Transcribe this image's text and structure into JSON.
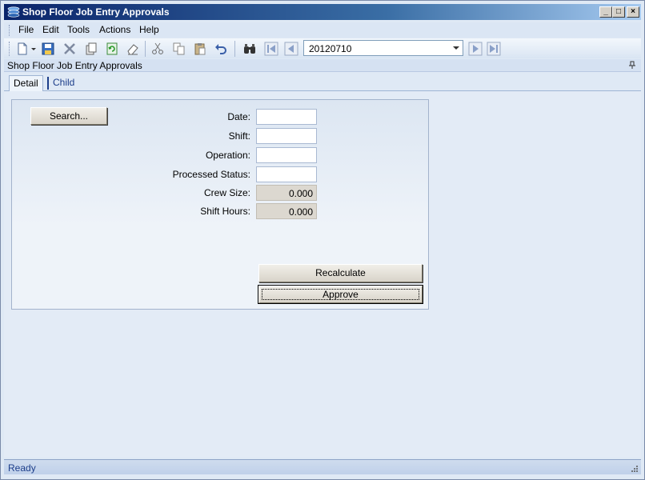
{
  "window": {
    "title": "Shop Floor Job Entry Approvals",
    "minimize_label": "_",
    "maximize_label": "□",
    "close_label": "×"
  },
  "menu": {
    "items": [
      {
        "label": "File"
      },
      {
        "label": "Edit"
      },
      {
        "label": "Tools"
      },
      {
        "label": "Actions"
      },
      {
        "label": "Help"
      }
    ]
  },
  "toolbar": {
    "icons": [
      "new-icon",
      "dropdown-arrow-icon",
      "save-icon",
      "delete-icon",
      "copy-record-icon",
      "refresh-icon",
      "eraser-icon",
      "cut-icon",
      "copy-icon",
      "paste-icon",
      "undo-icon",
      "find-icon",
      "first-record-icon",
      "previous-record-icon",
      "next-record-icon",
      "last-record-icon"
    ],
    "record_combo_value": "20120710"
  },
  "panel": {
    "title": "Shop Floor Job Entry Approvals"
  },
  "tabs": [
    {
      "label": "Detail",
      "active": true
    },
    {
      "label": "Child",
      "active": false
    }
  ],
  "form": {
    "search_button": "Search...",
    "fields": {
      "date": {
        "label": "Date:",
        "value": ""
      },
      "shift": {
        "label": "Shift:",
        "value": ""
      },
      "operation": {
        "label": "Operation:",
        "value": ""
      },
      "processed_status": {
        "label": "Processed Status:",
        "value": ""
      },
      "crew_size": {
        "label": "Crew Size:",
        "value": "0.000"
      },
      "shift_hours": {
        "label": "Shift Hours:",
        "value": "0.000"
      }
    },
    "recalculate_button": "Recalculate",
    "approve_button": "Approve"
  },
  "status": {
    "text": "Ready"
  },
  "colors": {
    "title_gradient_start": "#0a246a",
    "title_gradient_end": "#a6caf0",
    "content_background": "#e3ebf6",
    "readonly_field": "#dcd8d0",
    "link_blue": "#1c3e8a"
  }
}
